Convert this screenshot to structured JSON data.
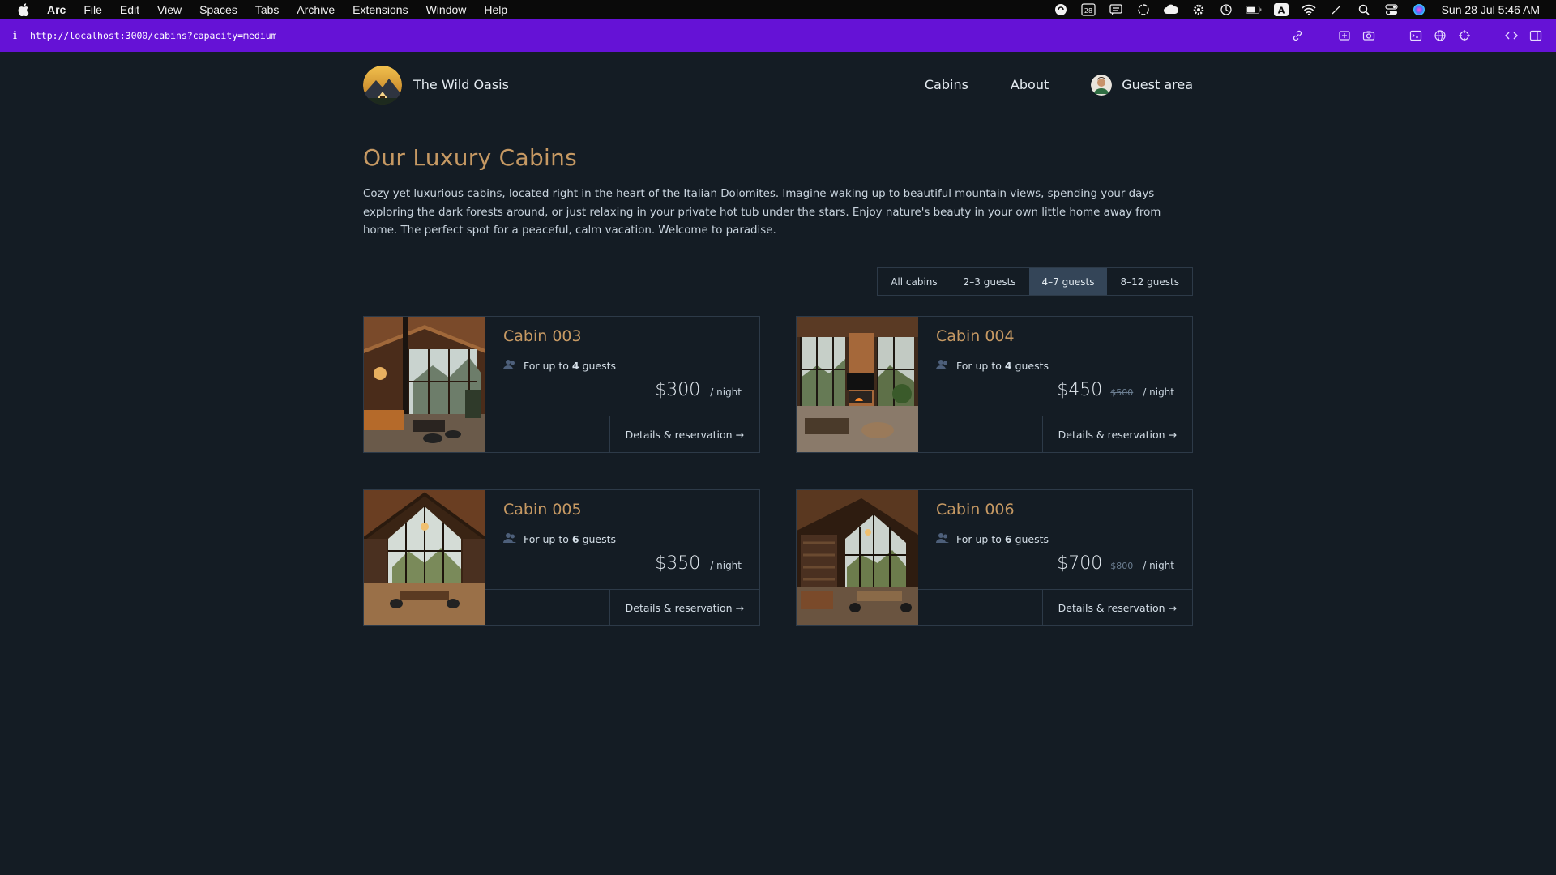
{
  "menubar": {
    "app": "Arc",
    "items": [
      "File",
      "Edit",
      "View",
      "Spaces",
      "Tabs",
      "Archive",
      "Extensions",
      "Window",
      "Help"
    ],
    "calendar_day": "28",
    "input_source": "A",
    "clock": "Sun 28 Jul  5:46 AM"
  },
  "urlbar": {
    "info_glyph": "i",
    "url": "http://localhost:3000/cabins?capacity=medium"
  },
  "header": {
    "logo_text": "The Wild Oasis",
    "nav": {
      "cabins": "Cabins",
      "about": "About",
      "guest_area": "Guest area"
    }
  },
  "main": {
    "title": "Our Luxury Cabins",
    "intro": "Cozy yet luxurious cabins, located right in the heart of the Italian Dolomites. Imagine waking up to beautiful mountain views, spending your days exploring the dark forests around, or just relaxing in your private hot tub under the stars. Enjoy nature's beauty in your own little home away from home. The perfect spot for a peaceful, calm vacation. Welcome to paradise.",
    "filters": [
      {
        "label": "All cabins",
        "active": false
      },
      {
        "label": "2–3 guests",
        "active": false
      },
      {
        "label": "4–7 guests",
        "active": true
      },
      {
        "label": "8–12 guests",
        "active": false
      }
    ]
  },
  "cabins": [
    {
      "name": "Cabin 003",
      "cap_prefix": "For up to",
      "capacity": "4",
      "cap_suffix": "guests",
      "price": "$300",
      "old_price": "",
      "per_night": "/ night",
      "cta": "Details & reservation →"
    },
    {
      "name": "Cabin 004",
      "cap_prefix": "For up to",
      "capacity": "4",
      "cap_suffix": "guests",
      "price": "$450",
      "old_price": "$500",
      "per_night": "/ night",
      "cta": "Details & reservation →"
    },
    {
      "name": "Cabin 005",
      "cap_prefix": "For up to",
      "capacity": "6",
      "cap_suffix": "guests",
      "price": "$350",
      "old_price": "",
      "per_night": "/ night",
      "cta": "Details & reservation →"
    },
    {
      "name": "Cabin 006",
      "cap_prefix": "For up to",
      "capacity": "6",
      "cap_suffix": "guests",
      "price": "$700",
      "old_price": "$800",
      "per_night": "/ night",
      "cta": "Details & reservation →"
    }
  ],
  "colors": {
    "background": "#141c24",
    "accent": "#c69963",
    "url_bar": "#6512d6",
    "active_filter": "#344558",
    "border": "#2d3a48"
  }
}
